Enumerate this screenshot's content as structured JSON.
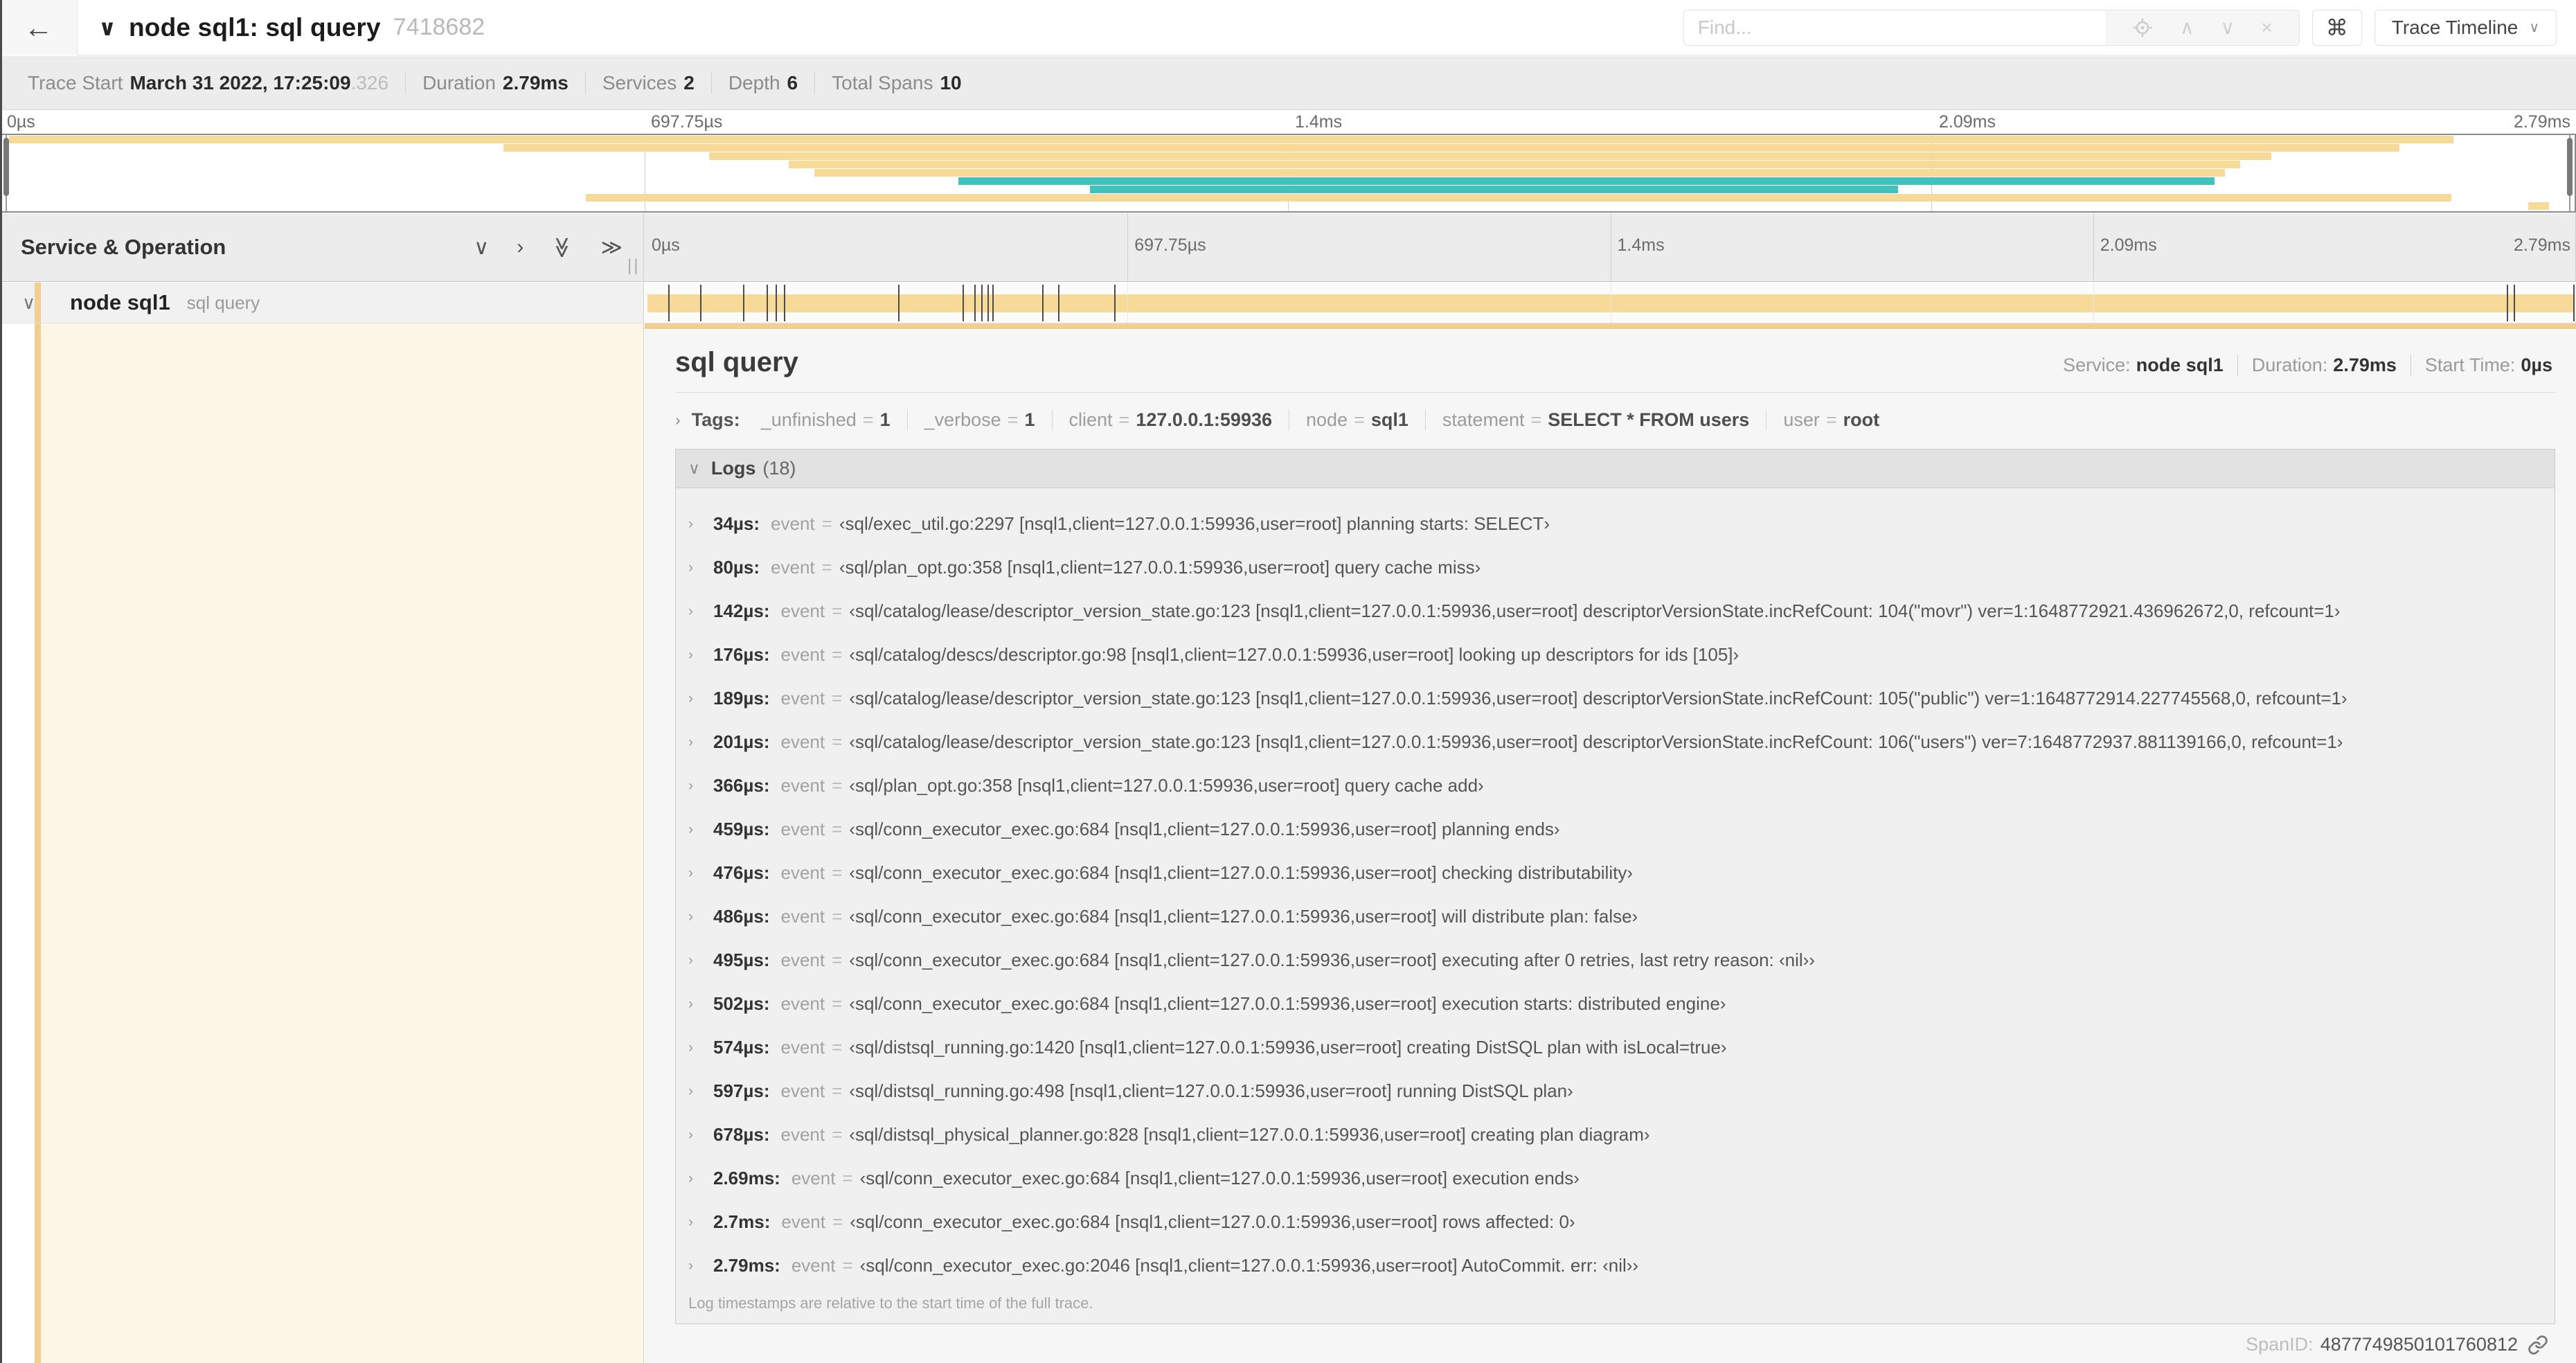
{
  "colors": {
    "tan": "#f7d998",
    "tan_strong": "#f3cf8e",
    "teal": "#41c3bd",
    "cream": "#fdf6e7"
  },
  "total_duration_us": 2790,
  "topnav": {
    "back_icon": "←",
    "chevron": "∨",
    "title": "node sql1: sql query",
    "trace_id": "7418682",
    "find_placeholder": "Find...",
    "find_up": "∧",
    "find_down": "∨",
    "find_clear": "×",
    "command_key": "⌘",
    "view_button": "Trace Timeline",
    "view_caret": "∨"
  },
  "infobar": {
    "items": [
      {
        "label": "Trace Start",
        "value": "March 31 2022, 17:25:09",
        "suffix": ".326"
      },
      {
        "label": "Duration",
        "value": "2.79ms"
      },
      {
        "label": "Services",
        "value": "2"
      },
      {
        "label": "Depth",
        "value": "6"
      },
      {
        "label": "Total Spans",
        "value": "10"
      }
    ]
  },
  "minimap": {
    "bars": [
      {
        "s": 0.3,
        "e": 95.3,
        "c": "tan"
      },
      {
        "s": 19.5,
        "e": 93.2,
        "c": "tan"
      },
      {
        "s": 27.5,
        "e": 88.2,
        "c": "tan"
      },
      {
        "s": 30.6,
        "e": 87.0,
        "c": "tan"
      },
      {
        "s": 31.6,
        "e": 86.4,
        "c": "tan"
      },
      {
        "s": 37.2,
        "e": 86.0,
        "c": "teal"
      },
      {
        "s": 42.3,
        "e": 73.7,
        "c": "teal"
      },
      {
        "s": 22.7,
        "e": 95.2,
        "c": "tan"
      },
      {
        "s": 98.2,
        "e": 99.0,
        "c": "tan"
      }
    ]
  },
  "timeline": {
    "left_header": "Service & Operation",
    "grip": "||",
    "ticks": [
      "0µs",
      "697.75µs",
      "1.4ms",
      "2.09ms",
      "2.79ms"
    ],
    "header_icons": [
      {
        "name": "collapse-one-icon",
        "glyph": "∨",
        "rot": false
      },
      {
        "name": "expand-one-icon",
        "glyph": "›",
        "rot": false
      },
      {
        "name": "collapse-all-icon",
        "glyph": "≫",
        "rot": true
      },
      {
        "name": "expand-all-icon",
        "glyph": "≫",
        "rot": false
      }
    ]
  },
  "span_row": {
    "chevron": "∨",
    "service": "node sql1",
    "operation": "sql query"
  },
  "detail": {
    "operation": "sql query",
    "service_label": "Service:",
    "service": "node sql1",
    "duration_label": "Duration:",
    "duration": "2.79ms",
    "start_time_label": "Start Time:",
    "start_time": "0µs",
    "tags_chevron": "›",
    "tags_label": "Tags:",
    "tags": [
      {
        "key": "_unfinished",
        "value": "1"
      },
      {
        "key": "_verbose",
        "value": "1"
      },
      {
        "key": "client",
        "value": "127.0.0.1:59936"
      },
      {
        "key": "node",
        "value": "sql1"
      },
      {
        "key": "statement",
        "value": "SELECT * FROM users"
      },
      {
        "key": "user",
        "value": "root"
      }
    ],
    "logs_chevron": "∨",
    "logs_label": "Logs",
    "logs_count": "(18)",
    "logs": [
      {
        "time": "34µs",
        "t_us": 34,
        "key": "event",
        "value": "‹sql/exec_util.go:2297 [nsql1,client=127.0.0.1:59936,user=root] planning starts: SELECT›"
      },
      {
        "time": "80µs",
        "t_us": 80,
        "key": "event",
        "value": "‹sql/plan_opt.go:358 [nsql1,client=127.0.0.1:59936,user=root] query cache miss›"
      },
      {
        "time": "142µs",
        "t_us": 142,
        "key": "event",
        "value": "‹sql/catalog/lease/descriptor_version_state.go:123 [nsql1,client=127.0.0.1:59936,user=root] descriptorVersionState.incRefCount: 104(\"movr\") ver=1:1648772921.436962672,0, refcount=1›"
      },
      {
        "time": "176µs",
        "t_us": 176,
        "key": "event",
        "value": "‹sql/catalog/descs/descriptor.go:98 [nsql1,client=127.0.0.1:59936,user=root] looking up descriptors for ids [105]›"
      },
      {
        "time": "189µs",
        "t_us": 189,
        "key": "event",
        "value": "‹sql/catalog/lease/descriptor_version_state.go:123 [nsql1,client=127.0.0.1:59936,user=root] descriptorVersionState.incRefCount: 105(\"public\") ver=1:1648772914.227745568,0, refcount=1›"
      },
      {
        "time": "201µs",
        "t_us": 201,
        "key": "event",
        "value": "‹sql/catalog/lease/descriptor_version_state.go:123 [nsql1,client=127.0.0.1:59936,user=root] descriptorVersionState.incRefCount: 106(\"users\") ver=7:1648772937.881139166,0, refcount=1›"
      },
      {
        "time": "366µs",
        "t_us": 366,
        "key": "event",
        "value": "‹sql/plan_opt.go:358 [nsql1,client=127.0.0.1:59936,user=root] query cache add›"
      },
      {
        "time": "459µs",
        "t_us": 459,
        "key": "event",
        "value": "‹sql/conn_executor_exec.go:684 [nsql1,client=127.0.0.1:59936,user=root] planning ends›"
      },
      {
        "time": "476µs",
        "t_us": 476,
        "key": "event",
        "value": "‹sql/conn_executor_exec.go:684 [nsql1,client=127.0.0.1:59936,user=root] checking distributability›"
      },
      {
        "time": "486µs",
        "t_us": 486,
        "key": "event",
        "value": "‹sql/conn_executor_exec.go:684 [nsql1,client=127.0.0.1:59936,user=root] will distribute plan: false›"
      },
      {
        "time": "495µs",
        "t_us": 495,
        "key": "event",
        "value": "‹sql/conn_executor_exec.go:684 [nsql1,client=127.0.0.1:59936,user=root] executing after 0 retries, last retry reason: ‹nil››"
      },
      {
        "time": "502µs",
        "t_us": 502,
        "key": "event",
        "value": "‹sql/conn_executor_exec.go:684 [nsql1,client=127.0.0.1:59936,user=root] execution starts: distributed engine›"
      },
      {
        "time": "574µs",
        "t_us": 574,
        "key": "event",
        "value": "‹sql/distsql_running.go:1420 [nsql1,client=127.0.0.1:59936,user=root] creating DistSQL plan with isLocal=true›"
      },
      {
        "time": "597µs",
        "t_us": 597,
        "key": "event",
        "value": "‹sql/distsql_running.go:498 [nsql1,client=127.0.0.1:59936,user=root] running DistSQL plan›"
      },
      {
        "time": "678µs",
        "t_us": 678,
        "key": "event",
        "value": "‹sql/distsql_physical_planner.go:828 [nsql1,client=127.0.0.1:59936,user=root] creating plan diagram›"
      },
      {
        "time": "2.69ms",
        "t_us": 2690,
        "key": "event",
        "value": "‹sql/conn_executor_exec.go:684 [nsql1,client=127.0.0.1:59936,user=root] execution ends›"
      },
      {
        "time": "2.7ms",
        "t_us": 2700,
        "key": "event",
        "value": "‹sql/conn_executor_exec.go:684 [nsql1,client=127.0.0.1:59936,user=root] rows affected: 0›"
      },
      {
        "time": "2.79ms",
        "t_us": 2790,
        "key": "event",
        "value": "‹sql/conn_executor_exec.go:2046 [nsql1,client=127.0.0.1:59936,user=root] AutoCommit. err: ‹nil››"
      }
    ],
    "logs_note": "Log timestamps are relative to the start time of the full trace.",
    "span_id_label": "SpanID:",
    "span_id": "4877749850101760812"
  }
}
